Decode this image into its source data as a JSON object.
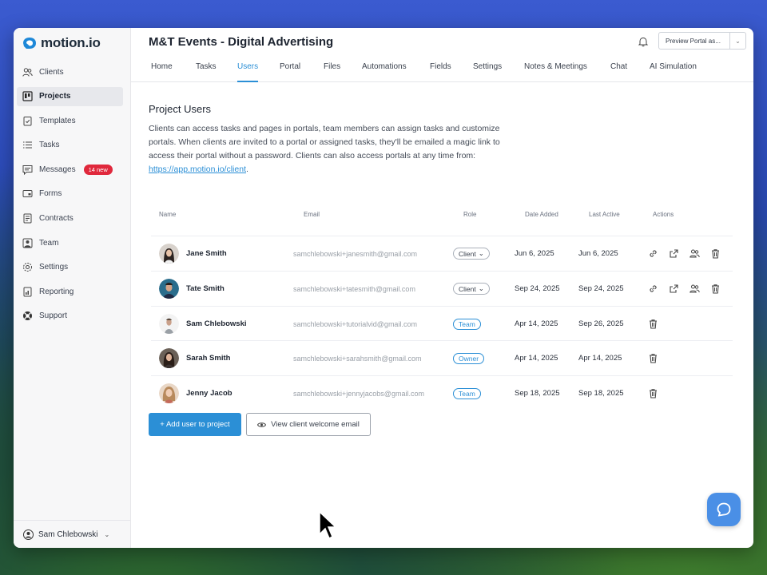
{
  "app": {
    "logo_text": "motion.io"
  },
  "sidebar": {
    "items": [
      {
        "label": "Clients",
        "icon": "clients-icon"
      },
      {
        "label": "Projects",
        "icon": "projects-icon",
        "active": true
      },
      {
        "label": "Templates",
        "icon": "templates-icon"
      },
      {
        "label": "Tasks",
        "icon": "tasks-icon"
      },
      {
        "label": "Messages",
        "icon": "messages-icon",
        "badge": "14 new"
      },
      {
        "label": "Forms",
        "icon": "forms-icon"
      },
      {
        "label": "Contracts",
        "icon": "contracts-icon"
      },
      {
        "label": "Team",
        "icon": "team-icon"
      },
      {
        "label": "Settings",
        "icon": "settings-icon"
      },
      {
        "label": "Reporting",
        "icon": "reporting-icon"
      },
      {
        "label": "Support",
        "icon": "support-icon"
      }
    ],
    "user": {
      "name": "Sam Chlebowski"
    }
  },
  "header": {
    "project_title": "M&T Events - Digital Advertising",
    "preview_label": "Preview Portal as..."
  },
  "tabs": [
    {
      "label": "Home"
    },
    {
      "label": "Tasks"
    },
    {
      "label": "Users",
      "active": true
    },
    {
      "label": "Portal"
    },
    {
      "label": "Files"
    },
    {
      "label": "Automations"
    },
    {
      "label": "Fields"
    },
    {
      "label": "Settings"
    },
    {
      "label": "Notes & Meetings"
    },
    {
      "label": "Chat"
    },
    {
      "label": "AI Simulation"
    }
  ],
  "content": {
    "section_title": "Project Users",
    "description": "Clients can access tasks and pages in portals, team members can assign tasks and customize portals. When clients are invited to a portal or assigned tasks, they'll be emailed a magic link to access their portal without a password. Clients can also access portals at any time from:",
    "client_link": "https://app.motion.io/client",
    "link_suffix": "."
  },
  "table": {
    "headers": {
      "name": "Name",
      "email": "Email",
      "role": "Role",
      "date_added": "Date Added",
      "last_active": "Last Active",
      "actions": "Actions"
    },
    "rows": [
      {
        "name": "Jane Smith",
        "email": "samchlebowski+janesmith@gmail.com",
        "role": "Client",
        "role_type": "client",
        "date_added": "Jun 6, 2025",
        "last_active": "Jun 6, 2025"
      },
      {
        "name": "Tate Smith",
        "email": "samchlebowski+tatesmith@gmail.com",
        "role": "Client",
        "role_type": "client",
        "date_added": "Sep 24, 2025",
        "last_active": "Sep 24, 2025"
      },
      {
        "name": "Sam Chlebowski",
        "email": "samchlebowski+tutorialvid@gmail.com",
        "role": "Team",
        "role_type": "team",
        "date_added": "Apr 14, 2025",
        "last_active": "Sep 26, 2025"
      },
      {
        "name": "Sarah Smith",
        "email": "samchlebowski+sarahsmith@gmail.com",
        "role": "Owner",
        "role_type": "owner",
        "date_added": "Apr 14, 2025",
        "last_active": "Apr 14, 2025"
      },
      {
        "name": "Jenny Jacob",
        "email": "samchlebowski+jennyjacobs@gmail.com",
        "role": "Team",
        "role_type": "team",
        "date_added": "Sep 18, 2025",
        "last_active": "Sep 18, 2025"
      }
    ]
  },
  "buttons": {
    "add_user": "+ Add user to project",
    "view_welcome": "View client welcome email"
  },
  "colors": {
    "accent": "#2b8fd6",
    "badge": "#e0283c",
    "chat_fab": "#4a8fe6"
  }
}
